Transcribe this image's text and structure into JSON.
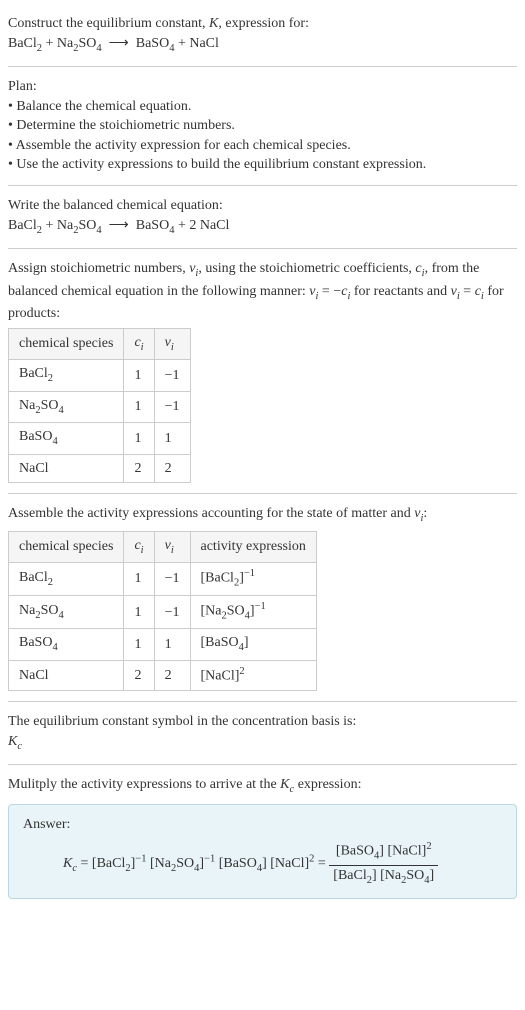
{
  "title": {
    "line1": "Construct the equilibrium constant, <span class=\"italic\">K</span>, expression for:",
    "line2": "BaCl<sub>2</sub> + Na<sub>2</sub>SO<sub>4</sub> &nbsp;⟶&nbsp; BaSO<sub>4</sub> + NaCl"
  },
  "plan": {
    "heading": "Plan:",
    "items": [
      "• Balance the chemical equation.",
      "• Determine the stoichiometric numbers.",
      "• Assemble the activity expression for each chemical species.",
      "• Use the activity expressions to build the equilibrium constant expression."
    ]
  },
  "balanced": {
    "heading": "Write the balanced chemical equation:",
    "equation": "BaCl<sub>2</sub> + Na<sub>2</sub>SO<sub>4</sub> &nbsp;⟶&nbsp; BaSO<sub>4</sub> + 2 NaCl"
  },
  "stoich": {
    "heading": "Assign stoichiometric numbers, <span class=\"italic\">ν<sub>i</sub></span>, using the stoichiometric coefficients, <span class=\"italic\">c<sub>i</sub></span>, from the balanced chemical equation in the following manner: <span class=\"italic\">ν<sub>i</sub></span> = −<span class=\"italic\">c<sub>i</sub></span> for reactants and <span class=\"italic\">ν<sub>i</sub></span> = <span class=\"italic\">c<sub>i</sub></span> for products:",
    "headers": [
      "chemical species",
      "<span class=\"italic\">c<sub>i</sub></span>",
      "<span class=\"italic\">ν<sub>i</sub></span>"
    ],
    "rows": [
      [
        "BaCl<sub>2</sub>",
        "1",
        "−1"
      ],
      [
        "Na<sub>2</sub>SO<sub>4</sub>",
        "1",
        "−1"
      ],
      [
        "BaSO<sub>4</sub>",
        "1",
        "1"
      ],
      [
        "NaCl",
        "2",
        "2"
      ]
    ]
  },
  "activity": {
    "heading": "Assemble the activity expressions accounting for the state of matter and <span class=\"italic\">ν<sub>i</sub></span>:",
    "headers": [
      "chemical species",
      "<span class=\"italic\">c<sub>i</sub></span>",
      "<span class=\"italic\">ν<sub>i</sub></span>",
      "activity expression"
    ],
    "rows": [
      [
        "BaCl<sub>2</sub>",
        "1",
        "−1",
        "[BaCl<sub>2</sub>]<sup>−1</sup>"
      ],
      [
        "Na<sub>2</sub>SO<sub>4</sub>",
        "1",
        "−1",
        "[Na<sub>2</sub>SO<sub>4</sub>]<sup>−1</sup>"
      ],
      [
        "BaSO<sub>4</sub>",
        "1",
        "1",
        "[BaSO<sub>4</sub>]"
      ],
      [
        "NaCl",
        "2",
        "2",
        "[NaCl]<sup>2</sup>"
      ]
    ]
  },
  "symbol": {
    "heading": "The equilibrium constant symbol in the concentration basis is:",
    "value": "<span class=\"italic\">K<sub>c</sub></span>"
  },
  "final": {
    "heading": "Mulitply the activity expressions to arrive at the <span class=\"italic\">K<sub>c</sub></span> expression:",
    "answer_label": "Answer:",
    "expression_lhs": "<span class=\"italic\">K<sub>c</sub></span> = [BaCl<sub>2</sub>]<sup>−1</sup> [Na<sub>2</sub>SO<sub>4</sub>]<sup>−1</sup> [BaSO<sub>4</sub>] [NaCl]<sup>2</sup> = ",
    "fraction_num": "[BaSO<sub>4</sub>] [NaCl]<sup>2</sup>",
    "fraction_den": "[BaCl<sub>2</sub>] [Na<sub>2</sub>SO<sub>4</sub>]"
  }
}
